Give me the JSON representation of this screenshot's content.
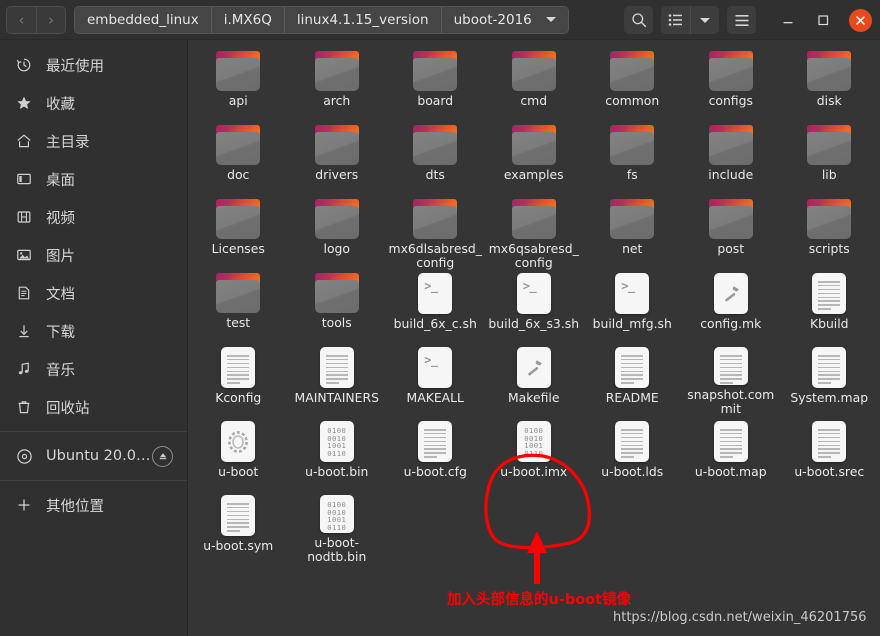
{
  "window": {
    "nav": {
      "back": "‹",
      "forward": "›"
    },
    "breadcrumbs": [
      "embedded_linux",
      "i.MX6Q",
      "linux4.1.15_version",
      "uboot-2016"
    ],
    "breadcrumb_caret": "dropdown-caret",
    "toolbar": {
      "search": "search-icon",
      "list_view": "list-view-icon",
      "view_caret": "view-dropdown-caret",
      "menu": "hamburger-menu-icon"
    },
    "controls": {
      "minimize": "—",
      "maximize": "□",
      "close": "✕"
    },
    "accent_close": "#e8491f"
  },
  "sidebar": {
    "items": [
      {
        "label": "最近使用",
        "icon": "recent-clock-icon"
      },
      {
        "label": "收藏",
        "icon": "star-icon"
      },
      {
        "label": "主目录",
        "icon": "home-icon"
      },
      {
        "label": "桌面",
        "icon": "desktop-icon"
      },
      {
        "label": "视频",
        "icon": "video-film-icon"
      },
      {
        "label": "图片",
        "icon": "pictures-image-icon"
      },
      {
        "label": "文档",
        "icon": "documents-icon"
      },
      {
        "label": "下载",
        "icon": "download-arrow-icon"
      },
      {
        "label": "音乐",
        "icon": "music-note-icon"
      },
      {
        "label": "回收站",
        "icon": "trash-icon"
      }
    ],
    "device": {
      "label": "Ubuntu 20.0…",
      "icon": "disc-icon",
      "eject": "eject-icon"
    },
    "other_locations": {
      "label": "其他位置",
      "icon": "plus-icon"
    }
  },
  "files": [
    {
      "name": "api",
      "type": "folder"
    },
    {
      "name": "arch",
      "type": "folder"
    },
    {
      "name": "board",
      "type": "folder"
    },
    {
      "name": "cmd",
      "type": "folder"
    },
    {
      "name": "common",
      "type": "folder"
    },
    {
      "name": "configs",
      "type": "folder"
    },
    {
      "name": "disk",
      "type": "folder"
    },
    {
      "name": "doc",
      "type": "folder"
    },
    {
      "name": "drivers",
      "type": "folder"
    },
    {
      "name": "dts",
      "type": "folder"
    },
    {
      "name": "examples",
      "type": "folder"
    },
    {
      "name": "fs",
      "type": "folder"
    },
    {
      "name": "include",
      "type": "folder"
    },
    {
      "name": "lib",
      "type": "folder"
    },
    {
      "name": "Licenses",
      "type": "folder"
    },
    {
      "name": "logo",
      "type": "folder"
    },
    {
      "name": "mx6dlsabresd_config",
      "type": "folder"
    },
    {
      "name": "mx6qsabresd_config",
      "type": "folder"
    },
    {
      "name": "net",
      "type": "folder"
    },
    {
      "name": "post",
      "type": "folder"
    },
    {
      "name": "scripts",
      "type": "folder"
    },
    {
      "name": "test",
      "type": "folder"
    },
    {
      "name": "tools",
      "type": "folder"
    },
    {
      "name": "build_6x_c.sh",
      "type": "script"
    },
    {
      "name": "build_6x_s3.sh",
      "type": "script"
    },
    {
      "name": "build_mfg.sh",
      "type": "script"
    },
    {
      "name": "config.mk",
      "type": "makefile"
    },
    {
      "name": "Kbuild",
      "type": "text"
    },
    {
      "name": "Kconfig",
      "type": "text"
    },
    {
      "name": "MAINTAINERS",
      "type": "text"
    },
    {
      "name": "MAKEALL",
      "type": "script"
    },
    {
      "name": "Makefile",
      "type": "makefile"
    },
    {
      "name": "README",
      "type": "text"
    },
    {
      "name": "snapshot.commit",
      "type": "text"
    },
    {
      "name": "System.map",
      "type": "text"
    },
    {
      "name": "u-boot",
      "type": "executable"
    },
    {
      "name": "u-boot.bin",
      "type": "binary"
    },
    {
      "name": "u-boot.cfg",
      "type": "text"
    },
    {
      "name": "u-boot.imx",
      "type": "binary",
      "highlighted": true
    },
    {
      "name": "u-boot.lds",
      "type": "text"
    },
    {
      "name": "u-boot.map",
      "type": "text"
    },
    {
      "name": "u-boot.srec",
      "type": "text"
    },
    {
      "name": "u-boot.sym",
      "type": "text"
    },
    {
      "name": "u-boot-nodtb.bin",
      "type": "binary"
    }
  ],
  "binary_icon_rows": [
    "0100",
    "0010",
    "1001",
    "0110"
  ],
  "annotation": {
    "text": "加入头部信息的u-boot镜像",
    "color": "#ff0000",
    "target": "u-boot.imx"
  },
  "watermark": "https://blog.csdn.net/weixin_46201756"
}
